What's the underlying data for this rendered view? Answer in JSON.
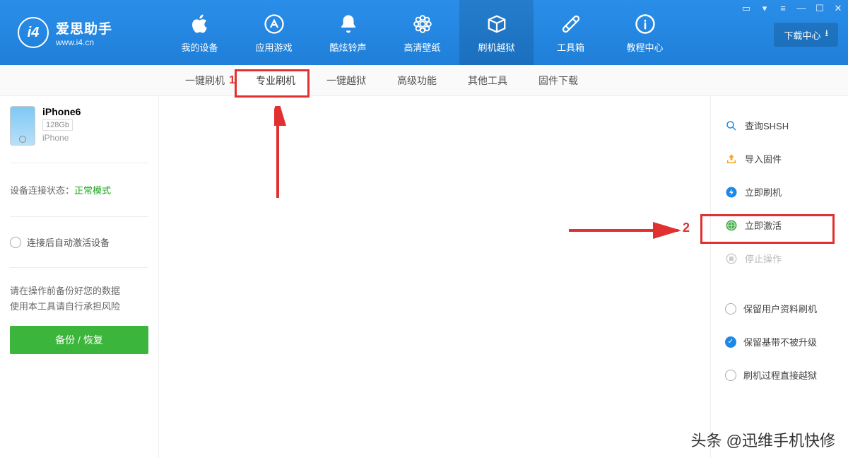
{
  "app": {
    "name_cn": "爱思助手",
    "name_en": "www.i4.cn",
    "logo_text": "i4"
  },
  "window_controls": {
    "download_center": "下载中心"
  },
  "nav": [
    {
      "label": "我的设备",
      "icon": "apple-icon"
    },
    {
      "label": "应用游戏",
      "icon": "appstore-icon"
    },
    {
      "label": "酷炫铃声",
      "icon": "bell-icon"
    },
    {
      "label": "高清壁纸",
      "icon": "flower-icon"
    },
    {
      "label": "刷机越狱",
      "icon": "box-icon",
      "active": true
    },
    {
      "label": "工具箱",
      "icon": "tools-icon"
    },
    {
      "label": "教程中心",
      "icon": "info-icon"
    }
  ],
  "tabs": [
    {
      "label": "一键刷机"
    },
    {
      "label": "专业刷机",
      "selected": true,
      "marker": "1"
    },
    {
      "label": "一键越狱"
    },
    {
      "label": "高级功能"
    },
    {
      "label": "其他工具"
    },
    {
      "label": "固件下载"
    }
  ],
  "device": {
    "name": "iPhone6",
    "capacity": "128Gb",
    "type": "iPhone"
  },
  "sidebar": {
    "status_label": "设备连接状态：",
    "status_mode": "正常模式",
    "activate_label": "连接后自动激活设备",
    "note_line1": "请在操作前备份好您的数据",
    "note_line2": "使用本工具请自行承担风险",
    "backup_button": "备份 / 恢复"
  },
  "right_panel": {
    "items": [
      {
        "label": "查询SHSH",
        "icon": "search-icon",
        "color": "#1e88e5"
      },
      {
        "label": "导入固件",
        "icon": "import-icon",
        "color": "#f5a623"
      },
      {
        "label": "立即刷机",
        "icon": "flash-icon",
        "color": "#1e88e5"
      },
      {
        "label": "立即激活",
        "icon": "activate-icon",
        "color": "#4caf50",
        "marker": "2"
      },
      {
        "label": "停止操作",
        "icon": "stop-icon",
        "disabled": true
      }
    ],
    "options": [
      {
        "label": "保留用户资料刷机",
        "checked": false
      },
      {
        "label": "保留基带不被升级",
        "checked": true
      },
      {
        "label": "刷机过程直接越狱",
        "checked": false
      }
    ]
  },
  "watermark": "头条 @迅维手机快修"
}
